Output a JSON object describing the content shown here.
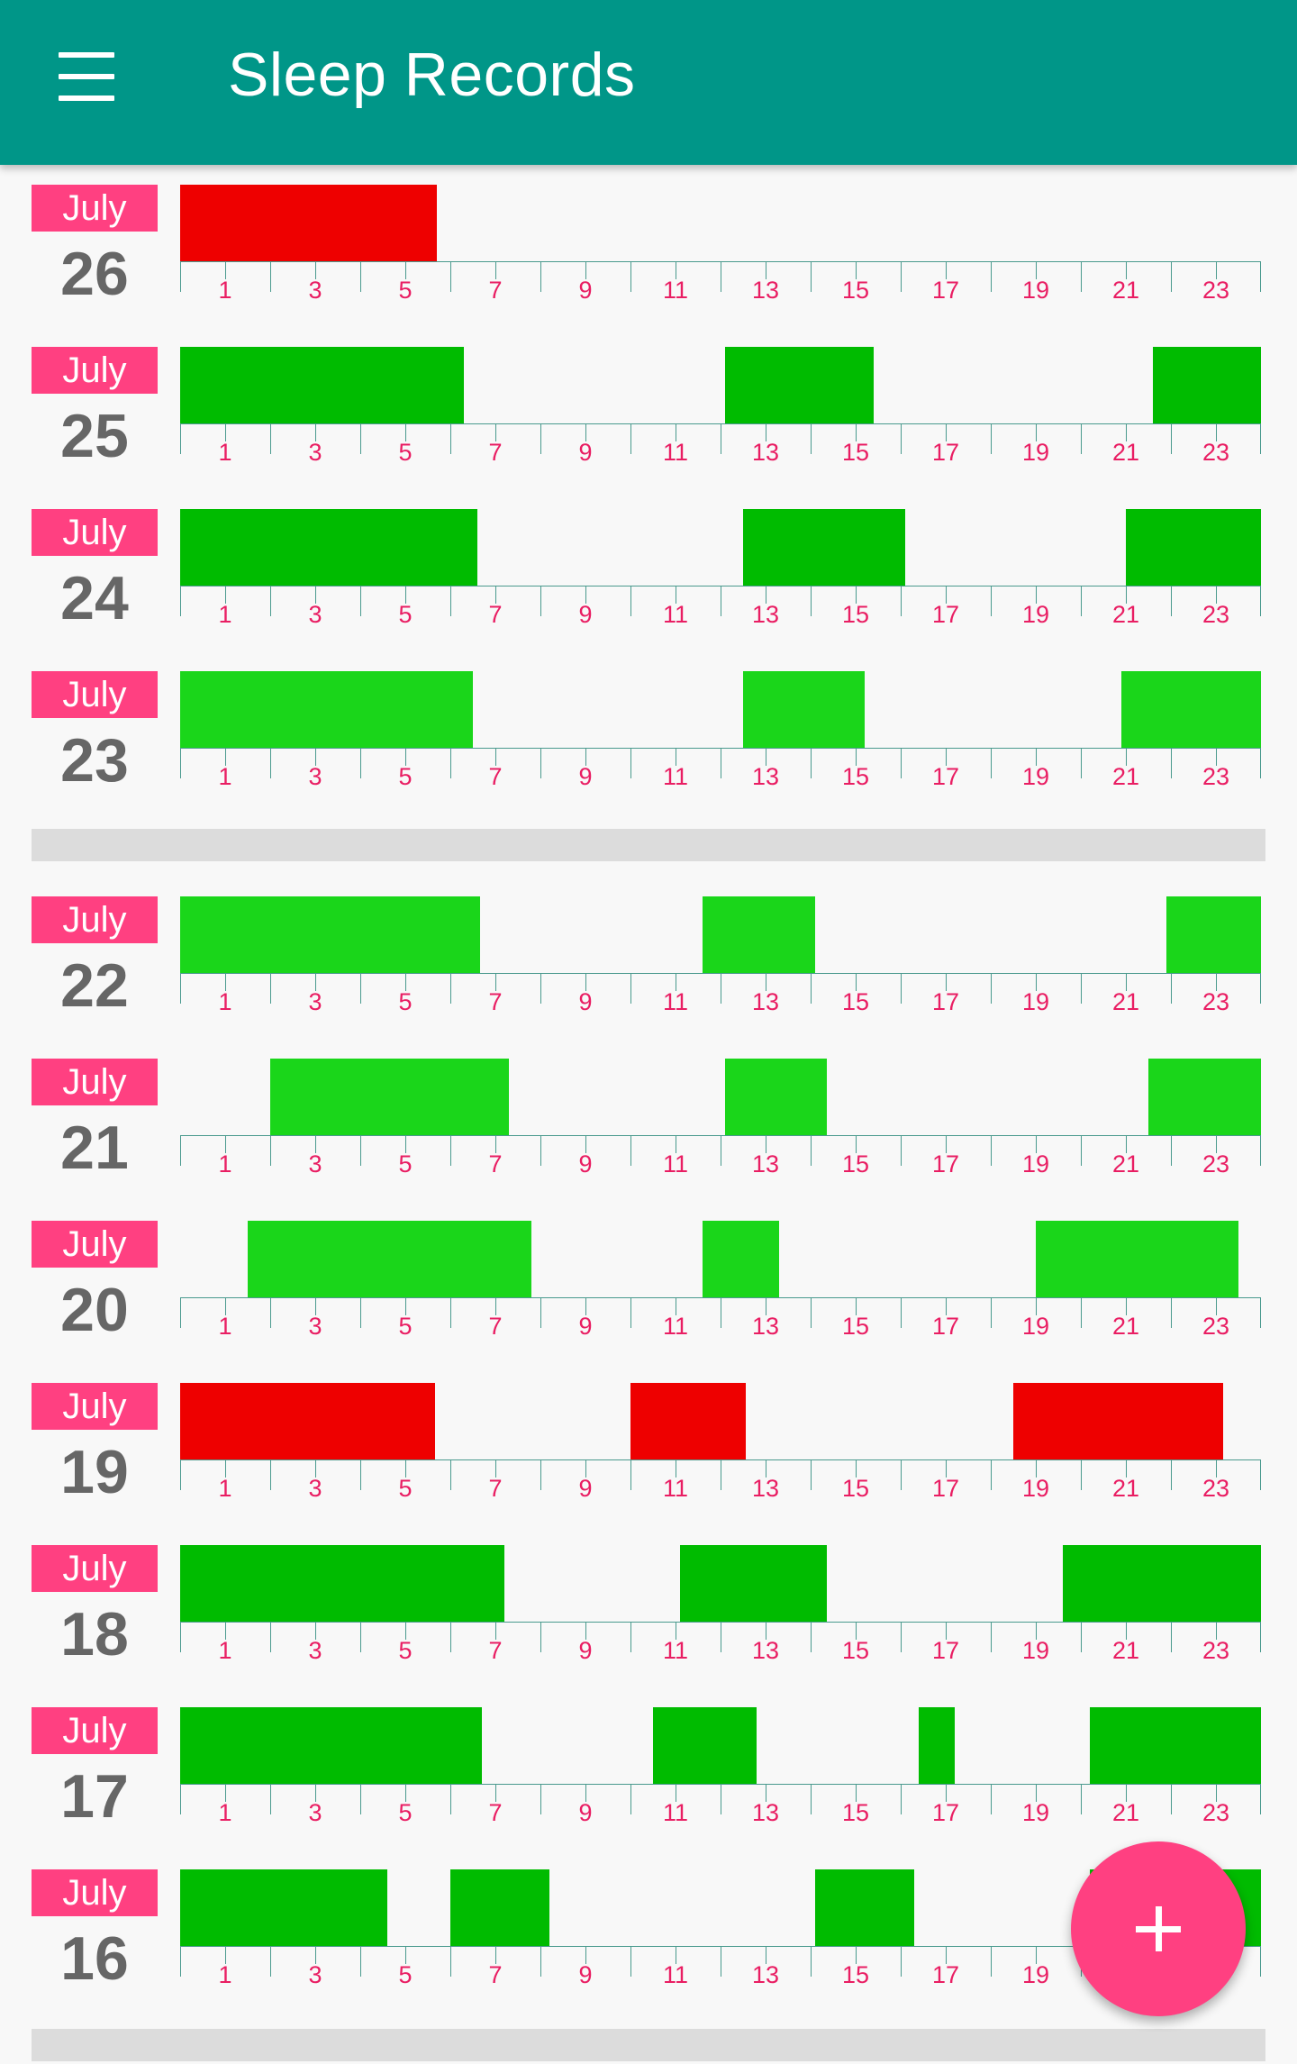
{
  "app_bar": {
    "title": "Sleep Records",
    "menu_icon": "menu-icon",
    "color": "#009688"
  },
  "fab": {
    "icon": "plus-icon",
    "color": "#ff4081"
  },
  "colors": {
    "red": "#ee0000",
    "dark_green": "#00bb00",
    "light_green": "#1ad61a",
    "tick_label": "#e91e63",
    "badge": "#ff4081"
  },
  "axis_labels": [
    "1",
    "3",
    "5",
    "7",
    "9",
    "11",
    "13",
    "15",
    "17",
    "19",
    "21",
    "23"
  ],
  "groups": [
    {
      "records": [
        {
          "month": "July",
          "day": "26",
          "color": "red",
          "sleeps": [
            [
              0,
              5.7
            ]
          ]
        },
        {
          "month": "July",
          "day": "25",
          "color": "dark_green",
          "sleeps": [
            [
              0,
              6.3
            ],
            [
              12.1,
              15.4
            ],
            [
              21.6,
              24
            ]
          ]
        },
        {
          "month": "July",
          "day": "24",
          "color": "dark_green",
          "sleeps": [
            [
              0,
              6.6
            ],
            [
              12.5,
              16.1
            ],
            [
              21.0,
              24
            ]
          ]
        },
        {
          "month": "July",
          "day": "23",
          "color": "light_green",
          "sleeps": [
            [
              0,
              6.5
            ],
            [
              12.5,
              15.2
            ],
            [
              20.9,
              24
            ]
          ]
        }
      ]
    },
    {
      "records": [
        {
          "month": "July",
          "day": "22",
          "color": "light_green",
          "sleeps": [
            [
              0,
              6.65
            ],
            [
              11.6,
              14.1
            ],
            [
              21.9,
              24
            ]
          ]
        },
        {
          "month": "July",
          "day": "21",
          "color": "light_green",
          "sleeps": [
            [
              2.0,
              7.3
            ],
            [
              12.1,
              14.35
            ],
            [
              21.5,
              24
            ]
          ]
        },
        {
          "month": "July",
          "day": "20",
          "color": "light_green",
          "sleeps": [
            [
              1.5,
              7.8
            ],
            [
              11.6,
              13.3
            ],
            [
              19.0,
              23.5
            ]
          ]
        },
        {
          "month": "July",
          "day": "19",
          "color": "red",
          "sleeps": [
            [
              0,
              5.65
            ],
            [
              10.0,
              12.55
            ],
            [
              18.5,
              23.15
            ]
          ]
        },
        {
          "month": "July",
          "day": "18",
          "color": "dark_green",
          "sleeps": [
            [
              0,
              7.2
            ],
            [
              11.1,
              14.35
            ],
            [
              19.6,
              24
            ]
          ]
        },
        {
          "month": "July",
          "day": "17",
          "color": "dark_green",
          "sleeps": [
            [
              0,
              6.7
            ],
            [
              10.5,
              12.8
            ],
            [
              16.4,
              17.2
            ],
            [
              20.2,
              24
            ]
          ]
        },
        {
          "month": "July",
          "day": "16",
          "color": "dark_green",
          "sleeps": [
            [
              0,
              4.6
            ],
            [
              6.0,
              8.2
            ],
            [
              14.1,
              16.3
            ],
            [
              20.2,
              24
            ]
          ]
        }
      ]
    }
  ]
}
